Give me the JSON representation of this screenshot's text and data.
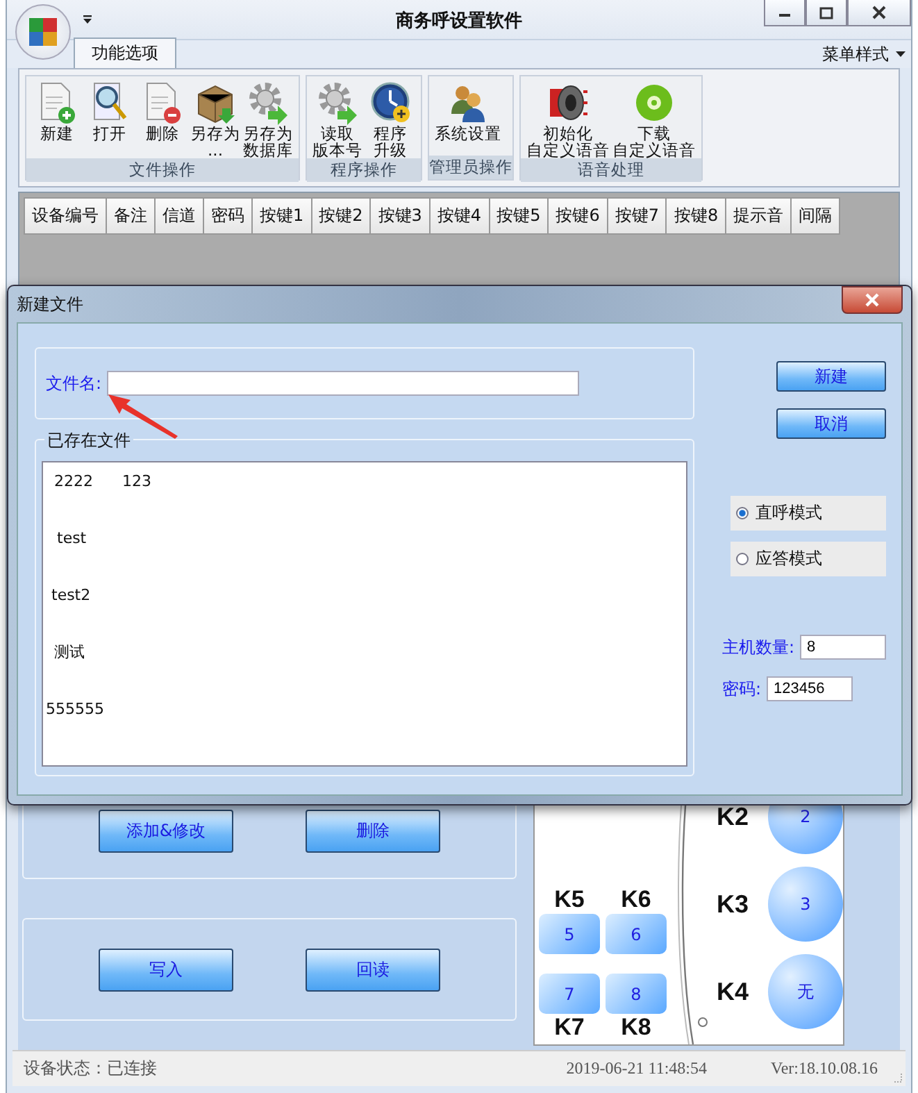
{
  "window": {
    "title": "商务呼设置软件"
  },
  "ribbon": {
    "tabs": [
      {
        "label": "功能选项",
        "selected": true
      }
    ],
    "menu_style": "菜单样式",
    "groups": [
      {
        "label": "文件操作",
        "buttons": [
          {
            "lines": [
              "新建"
            ],
            "kind": "doc-add"
          },
          {
            "lines": [
              "打开"
            ],
            "kind": "search-doc"
          },
          {
            "lines": [
              "删除"
            ],
            "kind": "doc-remove"
          },
          {
            "lines": [
              "另存为",
              "..."
            ],
            "kind": "box"
          },
          {
            "lines": [
              "另存为",
              "数据库"
            ],
            "kind": "gear"
          }
        ]
      },
      {
        "label": "程序操作",
        "buttons": [
          {
            "lines": [
              "读取",
              "版本号"
            ],
            "kind": "gear"
          },
          {
            "lines": [
              "程序",
              "升级"
            ],
            "kind": "clock"
          }
        ]
      },
      {
        "label": "管理员操作",
        "buttons": [
          {
            "lines": [
              "系统设置"
            ],
            "kind": "people"
          }
        ]
      },
      {
        "label": "语音处理",
        "buttons": [
          {
            "lines": [
              "初始化",
              "自定义语音"
            ],
            "kind": "speaker"
          },
          {
            "lines": [
              "下载",
              "自定义语音"
            ],
            "kind": "disc"
          }
        ]
      }
    ]
  },
  "table": {
    "columns": [
      "设备编号",
      "备注",
      "信道",
      "密码",
      "按键1",
      "按键2",
      "按键3",
      "按键4",
      "按键5",
      "按键6",
      "按键7",
      "按键8",
      "提示音",
      "间隔"
    ]
  },
  "panels": [
    {
      "buttons": [
        "添加&修改",
        "删除"
      ]
    },
    {
      "buttons": [
        "写入",
        "回读"
      ]
    }
  ],
  "keypad": {
    "small_keys": [
      {
        "label": "K5",
        "value": "5"
      },
      {
        "label": "K6",
        "value": "6"
      },
      {
        "label": "K7",
        "value": "7"
      },
      {
        "label": "K8",
        "value": "8"
      }
    ],
    "round_keys": [
      {
        "label": "K2",
        "value": "2"
      },
      {
        "label": "K3",
        "value": "3"
      },
      {
        "label": "K4",
        "value": "无"
      }
    ]
  },
  "status_bar": {
    "state": "设备状态：已连接",
    "time": "2019-06-21 11:48:54",
    "version": "Ver:18.10.08.16"
  },
  "dialog": {
    "title": "新建文件",
    "name_label": "文件名:",
    "existing_label": "已存在文件",
    "files": [
      "2222      123",
      "test",
      "test2",
      "测试",
      "555555"
    ],
    "buttons": [
      "新建",
      "取消"
    ],
    "modes": [
      {
        "label": "直呼模式",
        "selected": true
      },
      {
        "label": "应答模式",
        "selected": false
      }
    ],
    "fields": [
      {
        "label": "主机数量:",
        "value": "8"
      },
      {
        "label": "密码:",
        "value": "123456"
      }
    ]
  }
}
